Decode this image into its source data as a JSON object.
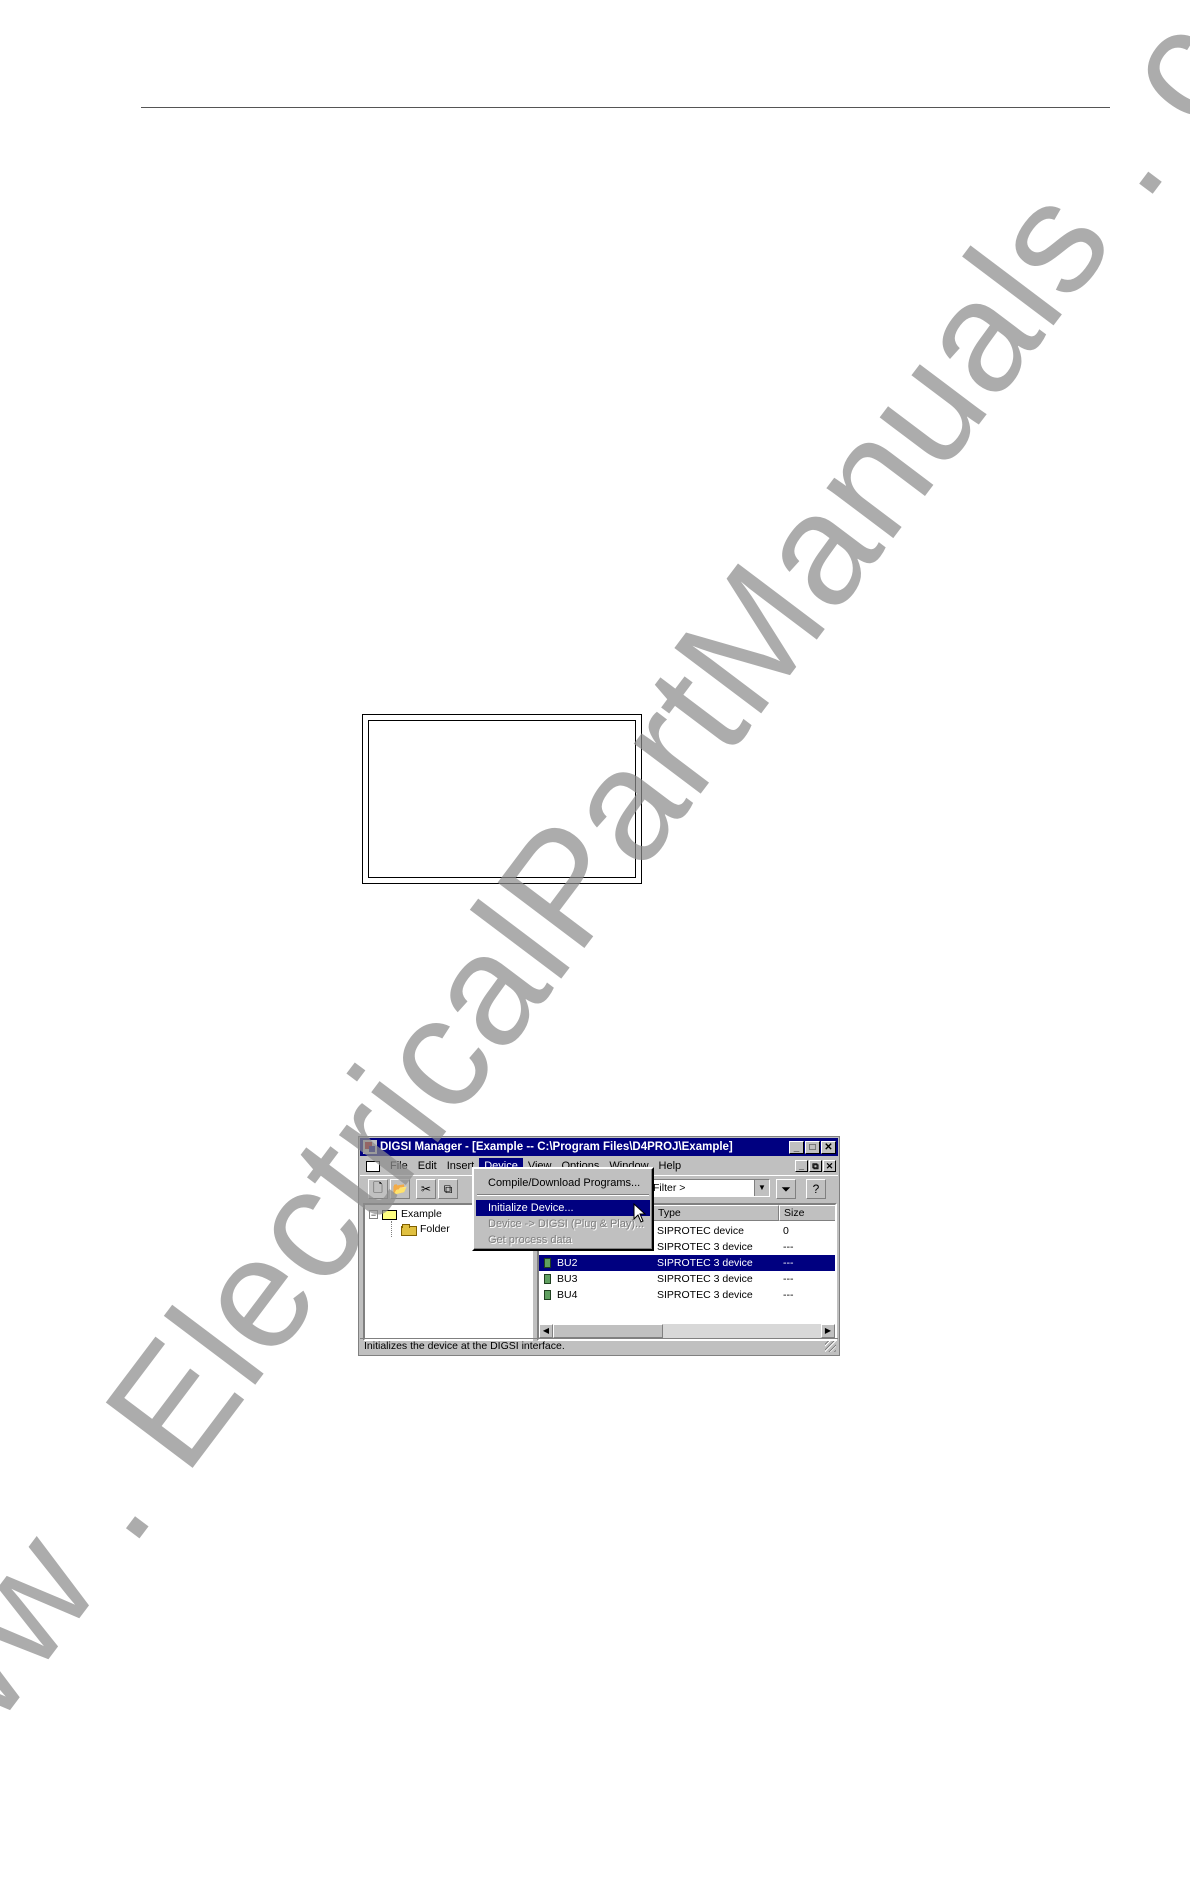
{
  "window": {
    "title": "DIGSI Manager - [Example -- C:\\Program Files\\D4PROJ\\Example]",
    "controls": {
      "minimize": "_",
      "maximize": "□",
      "close": "✕",
      "restore": "⧉"
    }
  },
  "menubar": {
    "items": [
      "File",
      "Edit",
      "Insert",
      "Device",
      "View",
      "Options",
      "Window",
      "Help"
    ]
  },
  "toolbar": {
    "filter_combo": "Filter >"
  },
  "device_menu": {
    "items": [
      {
        "label": "Compile/Download Programs..."
      },
      {
        "label": "Initialize Device..."
      },
      {
        "label": "Device -> DIGSI (Plug & Play)..."
      },
      {
        "label": "Get process data"
      }
    ]
  },
  "tree": {
    "root": "Example",
    "child": "Folder"
  },
  "list": {
    "columns": [
      "Type",
      "Size"
    ],
    "rows": [
      {
        "name": "",
        "type": "SIPROTEC device",
        "size": "0"
      },
      {
        "name": "",
        "type": "SIPROTEC 3 device",
        "size": "---"
      },
      {
        "name": "BU2",
        "type": "SIPROTEC 3 device",
        "size": "---"
      },
      {
        "name": "BU3",
        "type": "SIPROTEC 3 device",
        "size": "---"
      },
      {
        "name": "BU4",
        "type": "SIPROTEC 3 device",
        "size": "---"
      }
    ]
  },
  "statusbar": {
    "text": "Initializes the device at the DIGSI interface."
  },
  "watermark": {
    "text": "www . ElectricalPartManuals . com"
  }
}
